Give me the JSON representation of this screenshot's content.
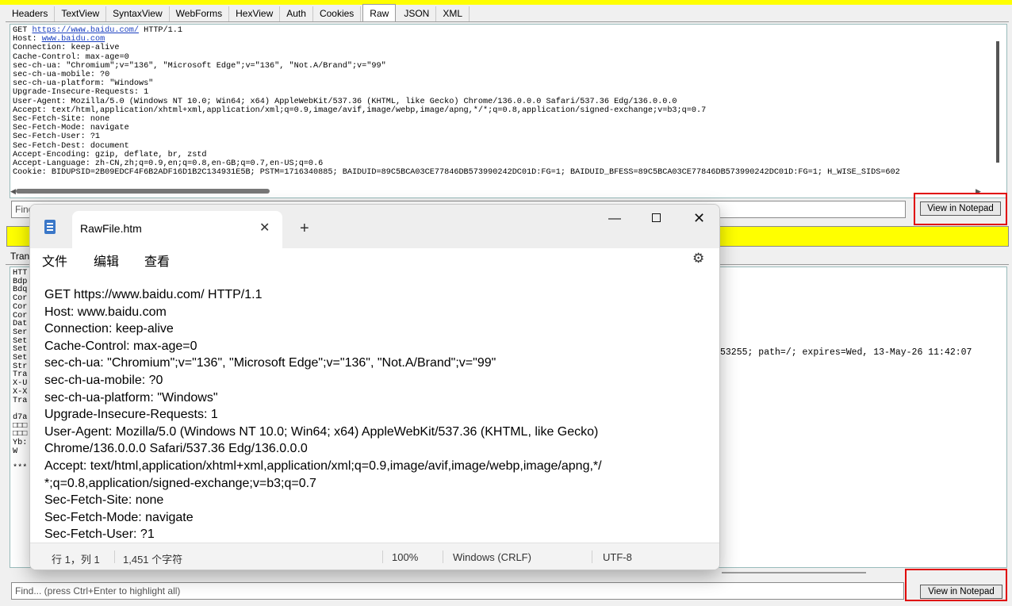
{
  "tabs": [
    "Headers",
    "TextView",
    "SyntaxView",
    "WebForms",
    "HexView",
    "Auth",
    "Cookies",
    "Raw",
    "JSON",
    "XML"
  ],
  "active_tab": "Raw",
  "request_raw": {
    "method": "GET",
    "url": "https://www.baidu.com/",
    "protocol": "HTTP/1.1",
    "host_label": "Host:",
    "host_value": "www.baidu.com",
    "rest": "Connection: keep-alive\nCache-Control: max-age=0\nsec-ch-ua: \"Chromium\";v=\"136\", \"Microsoft Edge\";v=\"136\", \"Not.A/Brand\";v=\"99\"\nsec-ch-ua-mobile: ?0\nsec-ch-ua-platform: \"Windows\"\nUpgrade-Insecure-Requests: 1\nUser-Agent: Mozilla/5.0 (Windows NT 10.0; Win64; x64) AppleWebKit/537.36 (KHTML, like Gecko) Chrome/136.0.0.0 Safari/537.36 Edg/136.0.0.0\nAccept: text/html,application/xhtml+xml,application/xml;q=0.9,image/avif,image/webp,image/apng,*/*;q=0.8,application/signed-exchange;v=b3;q=0.7\nSec-Fetch-Site: none\nSec-Fetch-Mode: navigate\nSec-Fetch-User: ?1\nSec-Fetch-Dest: document\nAccept-Encoding: gzip, deflate, br, zstd\nAccept-Language: zh-CN,zh;q=0.9,en;q=0.8,en-GB;q=0.7,en-US;q=0.6\nCookie: BIDUPSID=2B09EDCF4F6B2ADF16D1B2C134931E5B; PSTM=1716340885; BAIDUID=89C5BCA03CE77846DB573990242DC01D:FG=1; BAIDUID_BFESS=89C5BCA03CE77846DB573990242DC01D:FG=1; H_WISE_SIDS=602"
  },
  "find_placeholder_top": "Find... (press Ctrl+Enter to highlight all)",
  "find_placeholder_bottom": "Find... (press Ctrl+Enter to highlight all)",
  "view_in_notepad": "View in Notepad",
  "response_tab_label": "Tran",
  "response_left_lines": "HTT\nBdp\nBdq\nCor\nCor\nCor\nDat\nSer\nSet\nSet\nSet\nStr\nTra\nX-U\nX-X\nTra\n\nd7a\n□□□\n□□□\nYb:\nW\n\n***",
  "response_right_fragment": "53255; path=/; expires=Wed, 13-May-26 11:42:07",
  "notepad": {
    "tab_title": "RawFile.htm",
    "new_tab": "+",
    "menu": {
      "file": "文件",
      "edit": "编辑",
      "view": "查看"
    },
    "content": "GET https://www.baidu.com/ HTTP/1.1\nHost: www.baidu.com\nConnection: keep-alive\nCache-Control: max-age=0\nsec-ch-ua: \"Chromium\";v=\"136\", \"Microsoft Edge\";v=\"136\", \"Not.A/Brand\";v=\"99\"\nsec-ch-ua-mobile: ?0\nsec-ch-ua-platform: \"Windows\"\nUpgrade-Insecure-Requests: 1\nUser-Agent: Mozilla/5.0 (Windows NT 10.0; Win64; x64) AppleWebKit/537.36 (KHTML, like Gecko)\nChrome/136.0.0.0 Safari/537.36 Edg/136.0.0.0\nAccept: text/html,application/xhtml+xml,application/xml;q=0.9,image/avif,image/webp,image/apng,*/\n*;q=0.8,application/signed-exchange;v=b3;q=0.7\nSec-Fetch-Site: none\nSec-Fetch-Mode: navigate\nSec-Fetch-User: ?1",
    "status": {
      "position": "行 1，列 1",
      "chars": "1,451 个字符",
      "zoom": "100%",
      "line_ending": "Windows (CRLF)",
      "encoding": "UTF-8"
    }
  },
  "colors": {
    "highlight_bar": "#ffff00",
    "callout_box": "#e00000",
    "link": "#1a3fc0"
  }
}
